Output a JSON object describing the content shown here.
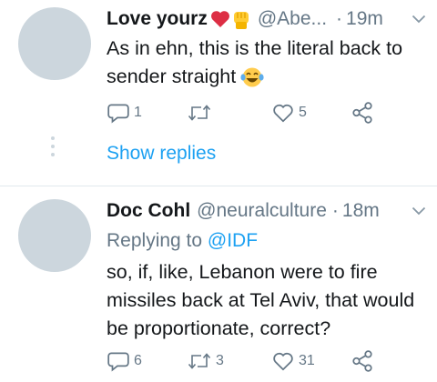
{
  "tweet1": {
    "display_name": "Love yourz",
    "badge_icons": [
      "heart-emoji",
      "raised-fist-emoji"
    ],
    "handle": "@Abe...",
    "separator": "·",
    "time": "19m",
    "text_line1": "As in ehn, this is the literal back to",
    "text_line2": "sender straight",
    "emoji": "laughing-tears-emoji",
    "actions": {
      "reply_count": "1",
      "retweet_count": "",
      "like_count": "5"
    },
    "show_replies_label": "Show replies"
  },
  "tweet2": {
    "display_name": "Doc Cohl",
    "handle": "@neuralculture",
    "separator": "·",
    "time": "18m",
    "replying_to_label": "Replying to",
    "replying_to_handle": "@IDF",
    "text_line1": "so, if, like, Lebanon were to fire",
    "text_line2": "missiles back at Tel Aviv, that would",
    "text_line3": "be proportionate, correct?",
    "actions": {
      "reply_count": "6",
      "retweet_count": "3",
      "like_count": "31"
    }
  },
  "colors": {
    "link_blue": "#1da1f2",
    "secondary_gray": "#657786",
    "avatar_placeholder": "#ccd6dd",
    "divider": "#e1e8ed"
  }
}
